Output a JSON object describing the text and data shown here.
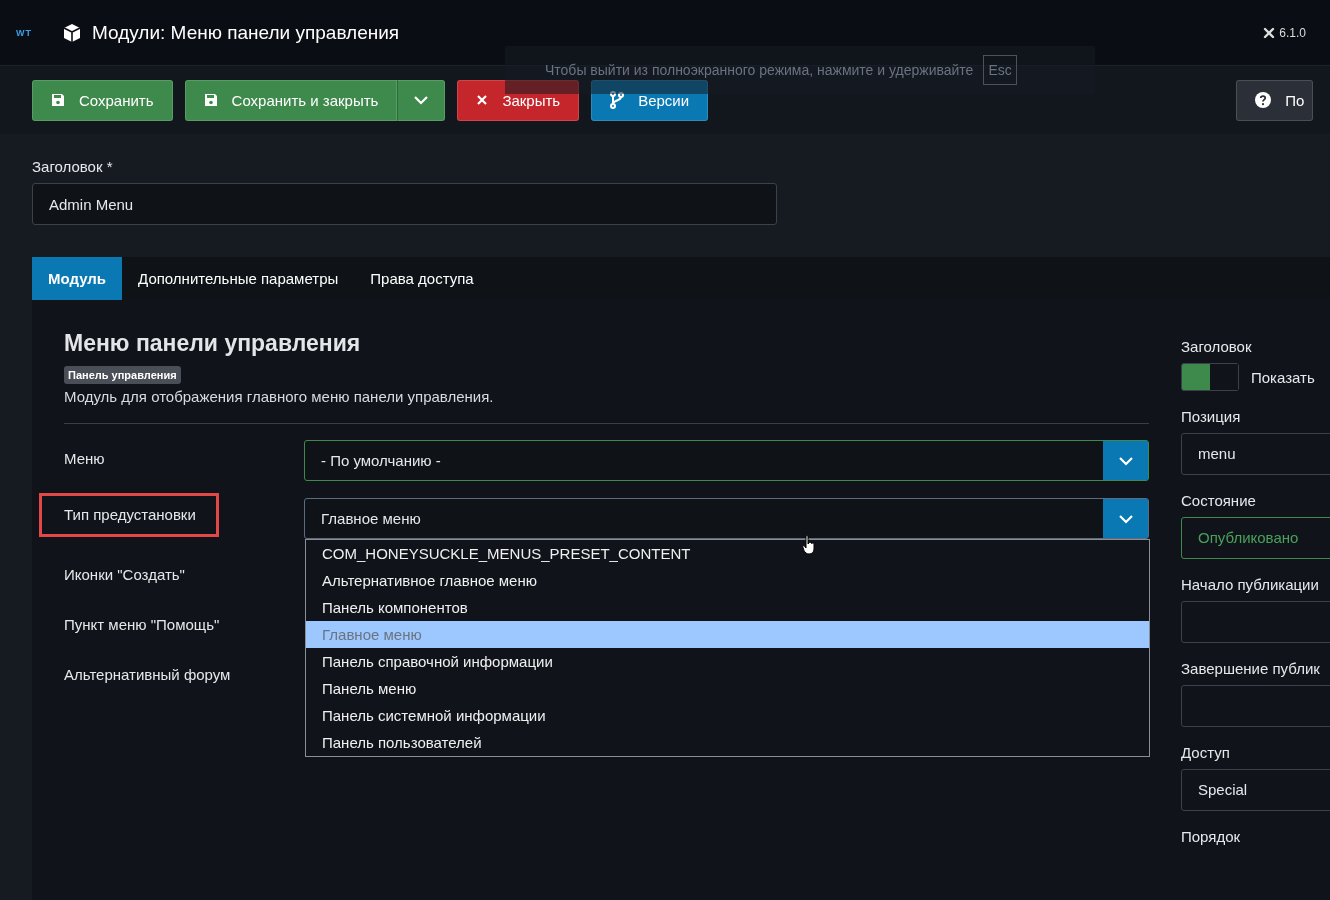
{
  "header": {
    "logo": "WT",
    "title": "Модули: Меню панели управления",
    "version": "6.1.0"
  },
  "fullscreen_notice": {
    "text": "Чтобы выйти из полноэкранного режима, нажмите и удерживайте",
    "key": "Esc"
  },
  "toolbar": [
    {
      "kind": "save",
      "label": "Сохранить"
    },
    {
      "kind": "save-split",
      "label": "Сохранить и закрыть"
    },
    {
      "kind": "close",
      "label": "Закрыть"
    },
    {
      "kind": "versions",
      "label": "Версии"
    },
    {
      "kind": "help",
      "label": "По"
    }
  ],
  "title_field": {
    "label": "Заголовок *",
    "value": "Admin Menu"
  },
  "tabs": [
    {
      "label": "Модуль",
      "selected": true
    },
    {
      "label": "Дополнительные параметры",
      "selected": false
    },
    {
      "label": "Права доступа",
      "selected": false
    }
  ],
  "module": {
    "heading": "Меню панели управления",
    "badge": "Панель управления",
    "description": "Модуль для отображения главного меню панели управления."
  },
  "fields": [
    {
      "label": "Меню",
      "kind": "select",
      "value": "- По умолчанию -",
      "highlighted": false
    },
    {
      "label": "Тип предустановки",
      "kind": "select-open",
      "value": "Главное меню",
      "highlighted": true
    },
    {
      "label": "Иконки \"Создать\"",
      "kind": "covered",
      "highlighted": false
    },
    {
      "label": "Пункт меню \"Помощь\"",
      "kind": "covered",
      "highlighted": false
    },
    {
      "label": "Альтернативный форум",
      "kind": "covered",
      "highlighted": false
    }
  ],
  "dropdown_options": [
    {
      "label": "COM_HONEYSUCKLE_MENUS_PRESET_CONTENT",
      "selected": false
    },
    {
      "label": "Альтернативное главное меню",
      "selected": false
    },
    {
      "label": "Панель компонентов",
      "selected": false
    },
    {
      "label": "Главное меню",
      "selected": true
    },
    {
      "label": "Панель справочной информации",
      "selected": false
    },
    {
      "label": "Панель меню",
      "selected": false
    },
    {
      "label": "Панель системной информации",
      "selected": false
    },
    {
      "label": "Панель пользователей",
      "selected": false
    }
  ],
  "sidebar": [
    {
      "label": "Заголовок",
      "kind": "toggle",
      "on": true,
      "text": "Показать"
    },
    {
      "label": "Позиция",
      "kind": "field",
      "value": "menu"
    },
    {
      "label": "Состояние",
      "kind": "status",
      "value": "Опубликовано"
    },
    {
      "label": "Начало публикации",
      "kind": "field"
    },
    {
      "label": "Завершение публик",
      "kind": "field"
    },
    {
      "label": "Доступ",
      "kind": "field",
      "value": "Special"
    },
    {
      "label": "Порядок",
      "kind": "label-only"
    }
  ]
}
